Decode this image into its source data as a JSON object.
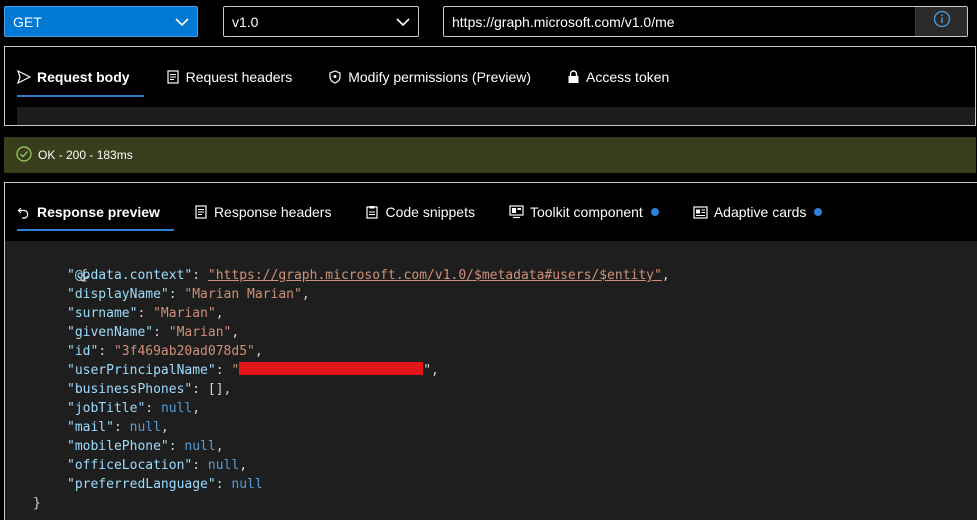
{
  "toolbar": {
    "method": "GET",
    "version": "v1.0",
    "url": "https://graph.microsoft.com/v1.0/me"
  },
  "request_tabs": [
    {
      "label": "Request body",
      "icon": "send-icon",
      "active": true
    },
    {
      "label": "Request headers",
      "icon": "document-icon",
      "active": false
    },
    {
      "label": "Modify permissions (Preview)",
      "icon": "shield-icon",
      "active": false
    },
    {
      "label": "Access token",
      "icon": "lock-icon",
      "active": false
    }
  ],
  "status": {
    "text": "OK - 200 - 183ms",
    "color": "#393d1b"
  },
  "response_tabs": [
    {
      "label": "Response preview",
      "icon": "undo-icon",
      "active": true
    },
    {
      "label": "Response headers",
      "icon": "document-icon",
      "active": false
    },
    {
      "label": "Code snippets",
      "icon": "clipboard-icon",
      "active": false
    },
    {
      "label": "Toolkit component",
      "icon": "toolkit-icon",
      "active": false,
      "dot": true
    },
    {
      "label": "Adaptive cards",
      "icon": "card-icon",
      "active": false,
      "dot": true
    }
  ],
  "response_json": {
    "open_brace": "{",
    "close_brace": "}",
    "entries": [
      {
        "key": "\"@odata.context\"",
        "value": "\"https://graph.microsoft.com/v1.0/$metadata#users/$entity\"",
        "type": "link"
      },
      {
        "key": "\"displayName\"",
        "value": "\"Marian Marian\"",
        "type": "string"
      },
      {
        "key": "\"surname\"",
        "value": "\"Marian\"",
        "type": "string"
      },
      {
        "key": "\"givenName\"",
        "value": "\"Marian\"",
        "type": "string"
      },
      {
        "key": "\"id\"",
        "value": "\"3f469ab20ad078d5\"",
        "type": "string"
      },
      {
        "key": "\"userPrincipalName\"",
        "value": "\"",
        "type": "redacted"
      },
      {
        "key": "\"businessPhones\"",
        "value": "[]",
        "type": "plain"
      },
      {
        "key": "\"jobTitle\"",
        "value": "null",
        "type": "null"
      },
      {
        "key": "\"mail\"",
        "value": "null",
        "type": "null"
      },
      {
        "key": "\"mobilePhone\"",
        "value": "null",
        "type": "null"
      },
      {
        "key": "\"officeLocation\"",
        "value": "null",
        "type": "null"
      },
      {
        "key": "\"preferredLanguage\"",
        "value": "null",
        "type": "null",
        "last": true
      }
    ]
  },
  "colors": {
    "accent": "#0078d4",
    "tab_underline": "#2f7fd6",
    "json_key": "#9cdcfe",
    "json_string": "#ce9178",
    "json_null": "#569cd6",
    "redaction": "#e3151a"
  }
}
